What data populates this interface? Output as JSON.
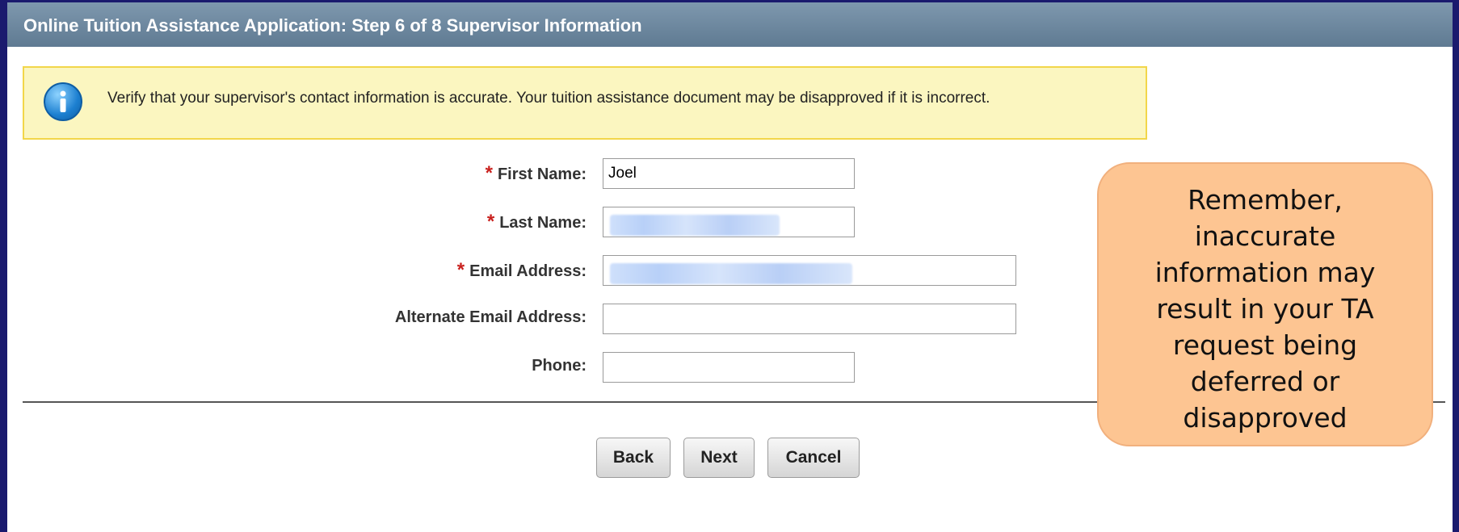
{
  "header": {
    "title": "Online Tuition Assistance Application: Step 6 of 8 Supervisor Information"
  },
  "notice": {
    "icon": "info-icon",
    "text": "Verify that your supervisor's contact information is accurate. Your tuition assistance document may be disapproved if it is incorrect."
  },
  "form": {
    "required_marker": "*",
    "first_name": {
      "label": "First Name:",
      "value": "Joel"
    },
    "last_name": {
      "label": "Last Name:",
      "value": ""
    },
    "email": {
      "label": "Email Address:",
      "value": ""
    },
    "alt_email": {
      "label": "Alternate Email Address:",
      "value": ""
    },
    "phone": {
      "label": "Phone:",
      "value": ""
    }
  },
  "buttons": {
    "back": "Back",
    "next": "Next",
    "cancel": "Cancel"
  },
  "callout": {
    "text": "Remember, inaccurate information may result in your TA request being deferred or disapproved",
    "color": "#fdc592"
  },
  "colors": {
    "header_bg": "#6f889f",
    "notice_bg": "#fbf6c0",
    "notice_border": "#f2d64a",
    "required": "#c9211e",
    "outer_bg": "#1a1a6e"
  }
}
